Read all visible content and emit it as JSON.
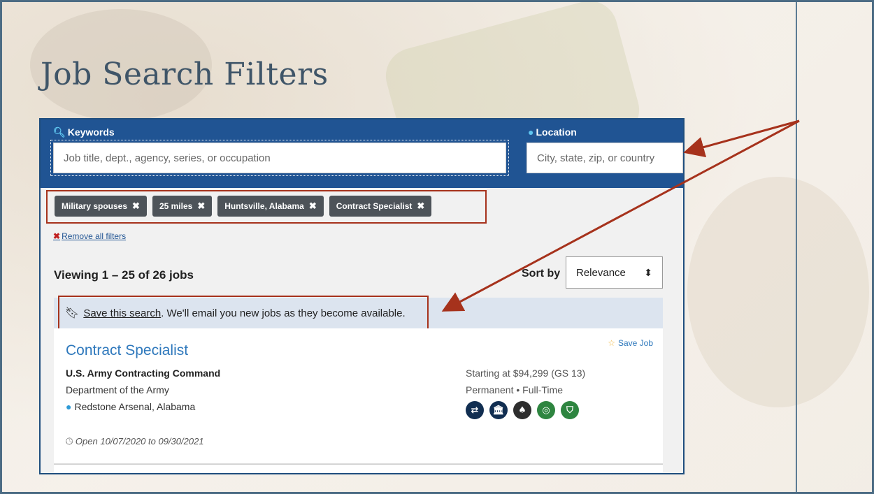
{
  "slide": {
    "title": "Job Search Filters"
  },
  "search": {
    "keywords_label": "Keywords",
    "keywords_placeholder": "Job title, dept., agency, series, or occupation",
    "location_label": "Location",
    "location_placeholder": "City, state, zip, or country"
  },
  "filters": {
    "chips": [
      {
        "label": "Military spouses"
      },
      {
        "label": "25 miles"
      },
      {
        "label": "Huntsville, Alabama"
      },
      {
        "label": "Contract Specialist"
      }
    ],
    "remove_all": "Remove all filters",
    "chip_close_glyph": "✖"
  },
  "results": {
    "viewing": "Viewing 1 – 25 of 26 jobs",
    "sort_label": "Sort by",
    "sort_value": "Relevance",
    "save_search_link": "Save this search",
    "save_search_rest": ". We'll email you new jobs as they become available."
  },
  "job": {
    "title": "Contract Specialist",
    "save_job": "Save Job",
    "agency": "U.S. Army Contracting Command",
    "department": "Department of the Army",
    "location": "Redstone Arsenal, Alabama",
    "salary": "Starting at $94,299 (GS 13)",
    "type": "Permanent • Full-Time",
    "open": "Open 10/07/2020 to 09/30/2021",
    "hiring_path_icons": [
      {
        "name": "transfer-icon",
        "glyph": "⇄",
        "color": "#112e51"
      },
      {
        "name": "federal-building-icon",
        "glyph": "🏛",
        "color": "#112e51"
      },
      {
        "name": "tree-icon",
        "glyph": "♠",
        "color": "#2e2e2e"
      },
      {
        "name": "rings-icon",
        "glyph": "◎",
        "color": "#2e8540"
      },
      {
        "name": "shield-icon",
        "glyph": "⛉",
        "color": "#2e8540"
      }
    ]
  },
  "colors": {
    "header_blue": "#205493",
    "callout_red": "#a6321c",
    "link_blue": "#2e78bc"
  }
}
